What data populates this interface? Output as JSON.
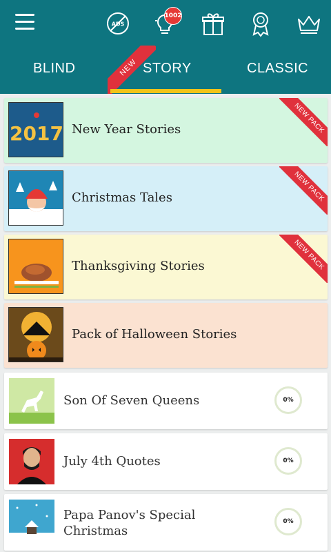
{
  "topbar": {
    "badge_count": "1002",
    "icons": [
      "menu-icon",
      "no-ads-icon",
      "hint-bulb-icon",
      "gift-icon",
      "award-icon",
      "crown-icon"
    ]
  },
  "tabs": [
    {
      "label": "BLIND"
    },
    {
      "label": "STORY",
      "selected": true,
      "ribbon": "NEW"
    },
    {
      "label": "CLASSIC"
    }
  ],
  "packs": [
    {
      "title": "New Year Stories",
      "ribbon": "NEW PACK",
      "bg": "#d4f6e0",
      "thumb_text": "2017"
    },
    {
      "title": "Christmas Tales",
      "ribbon": "NEW PACK",
      "bg": "#d5eff8"
    },
    {
      "title": "Thanksgiving Stories",
      "ribbon": "NEW PACK",
      "bg": "#fbf8d3"
    },
    {
      "title": "Pack of Halloween Stories",
      "bg": "#fbe2d1"
    }
  ],
  "stories": [
    {
      "title": "Son Of Seven Queens",
      "progress": "0%"
    },
    {
      "title": "July 4th Quotes",
      "progress": "0%"
    },
    {
      "title_line1": "Papa Panov's Special",
      "title_line2": "Christmas",
      "progress": "0%"
    }
  ],
  "colors": {
    "header": "#0e7580",
    "tab_indicator": "#f2c318",
    "ribbon": "#e0313c"
  }
}
